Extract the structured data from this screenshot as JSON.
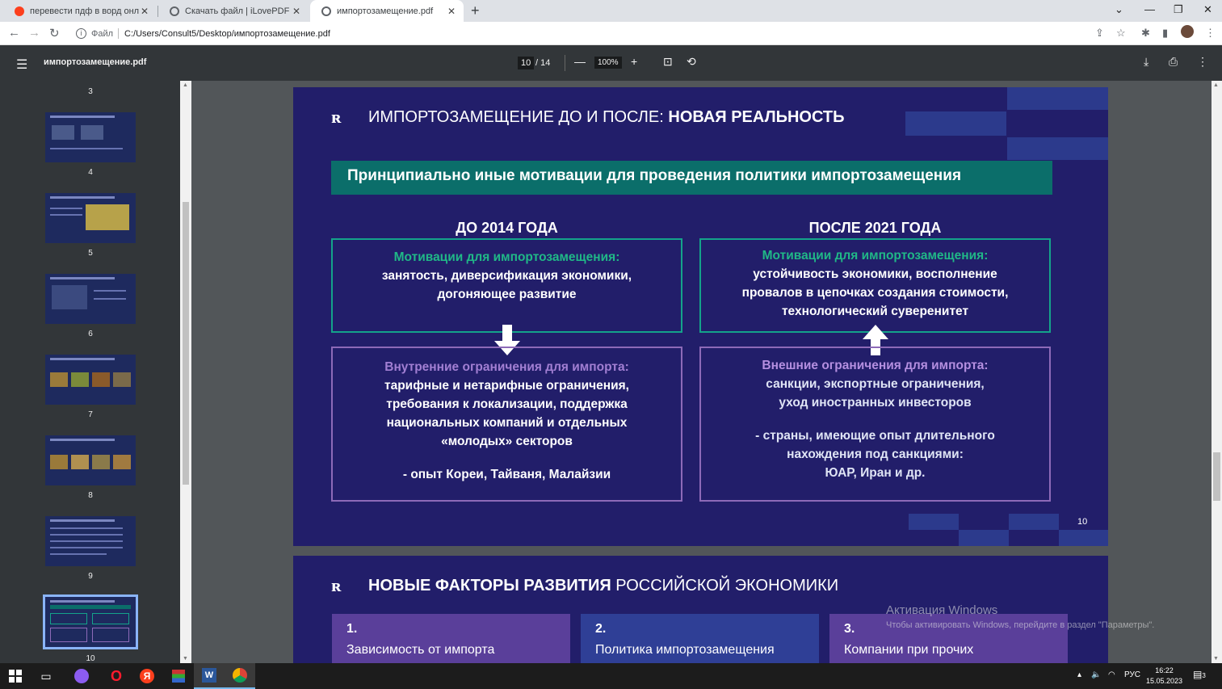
{
  "browser": {
    "tabs": [
      {
        "title": "перевести пдф в ворд онлайн б",
        "favicon": "yandex-icon"
      },
      {
        "title": "Скачать файл | iLovePDF",
        "favicon": "globe-icon"
      },
      {
        "title": "импортозамещение.pdf",
        "favicon": "globe-icon"
      }
    ],
    "address": {
      "scheme_label": "Файл",
      "url": "C:/Users/Consult5/Desktop/импортозамещение.pdf"
    }
  },
  "pdf_viewer": {
    "filename": "импортозамещение.pdf",
    "current_page": "10",
    "total_pages": "/ 14",
    "zoom": "100%"
  },
  "sidebar": {
    "thumbnails": [
      {
        "num": "3"
      },
      {
        "num": "4"
      },
      {
        "num": "5"
      },
      {
        "num": "6"
      },
      {
        "num": "7"
      },
      {
        "num": "8"
      },
      {
        "num": "9"
      },
      {
        "num": "10"
      }
    ]
  },
  "slide10": {
    "title_regular": "ИМПОРТОЗАМЕЩЕНИЕ ДО И ПОСЛЕ: ",
    "title_bold": "НОВАЯ РЕАЛЬНОСТЬ",
    "banner": "Принципиально иные мотивации для проведения политики импортозамещения",
    "left_head": "ДО 2014 ГОДА",
    "right_head": "ПОСЛЕ 2021 ГОДА",
    "left_top": {
      "title": "Мотивации для импортозамещения:",
      "lines": [
        "занятость, диверсификация экономики,",
        "догоняющее развитие"
      ]
    },
    "right_top": {
      "title": "Мотивации для импортозамещения:",
      "lines": [
        "устойчивость экономики, восполнение",
        "провалов в цепочках создания стоимости,",
        "технологический суверенитет"
      ]
    },
    "left_bottom": {
      "title": "Внутренние ограничения для импорта:",
      "lines": [
        "тарифные и нетарифные ограничения,",
        "требования к локализации, поддержка",
        "национальных компаний и отдельных",
        "«молодых» секторов"
      ],
      "note": "- опыт Кореи, Тайваня, Малайзии"
    },
    "right_bottom": {
      "title": "Внешние ограничения для импорта:",
      "lines": [
        "санкции, экспортные ограничения,",
        "уход иностранных инвесторов"
      ],
      "note_lines": [
        "- страны, имеющие опыт длительного",
        "нахождения под санкциями:",
        "ЮАР, Иран и др."
      ]
    },
    "page_number": "10"
  },
  "slide11": {
    "title_bold": "НОВЫЕ ФАКТОРЫ РАЗВИТИЯ",
    "title_regular": " РОССИЙСКОЙ ЭКОНОМИКИ",
    "cards": [
      {
        "num": "1.",
        "text": "Зависимость от импорта"
      },
      {
        "num": "2.",
        "text": "Политика импортозамещения"
      },
      {
        "num": "3.",
        "text": "Компании при прочих"
      }
    ]
  },
  "watermark": {
    "line1": "Активация Windows",
    "line2": "Чтобы активировать Windows, перейдите в раздел \"Параметры\"."
  },
  "taskbar": {
    "lang": "РУС",
    "time": "16:22",
    "date": "15.05.2023",
    "notif_count": "3"
  },
  "colors": {
    "slide_bg": "#221e6a",
    "banner": "#0b6e6a",
    "green_accent": "#20b887",
    "purple_accent": "#a27fd3"
  }
}
